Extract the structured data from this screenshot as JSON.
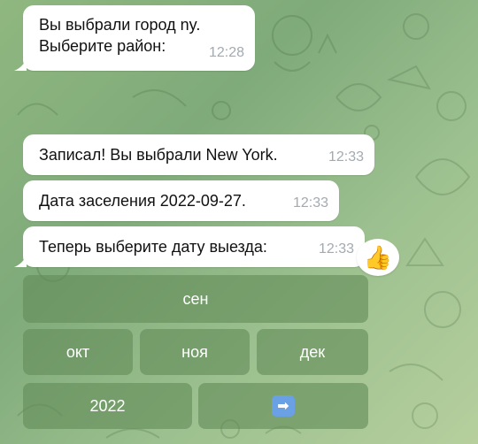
{
  "messages": [
    {
      "text": "Вы выбрали город ny.\nВыберите район:",
      "time": "12:28"
    },
    {
      "text": "Записал! Вы выбрали New York.",
      "time": "12:33"
    },
    {
      "text": "Дата заселения 2022-09-27.",
      "time": "12:33"
    },
    {
      "text": "Теперь выберите дату выезда:",
      "time": "12:33"
    }
  ],
  "reaction": {
    "emoji": "👍",
    "icon": "thumbs-up-icon"
  },
  "keyboard": {
    "row1": [
      "сен"
    ],
    "row2": [
      "окт",
      "ноя",
      "дек"
    ],
    "row3": [
      "2022",
      "➡"
    ]
  },
  "colors": {
    "bubble": "#ffffff",
    "timestamp": "#a3aab0",
    "keyboard_button": "#628c58",
    "arrow_button": "#6aa0e4"
  }
}
